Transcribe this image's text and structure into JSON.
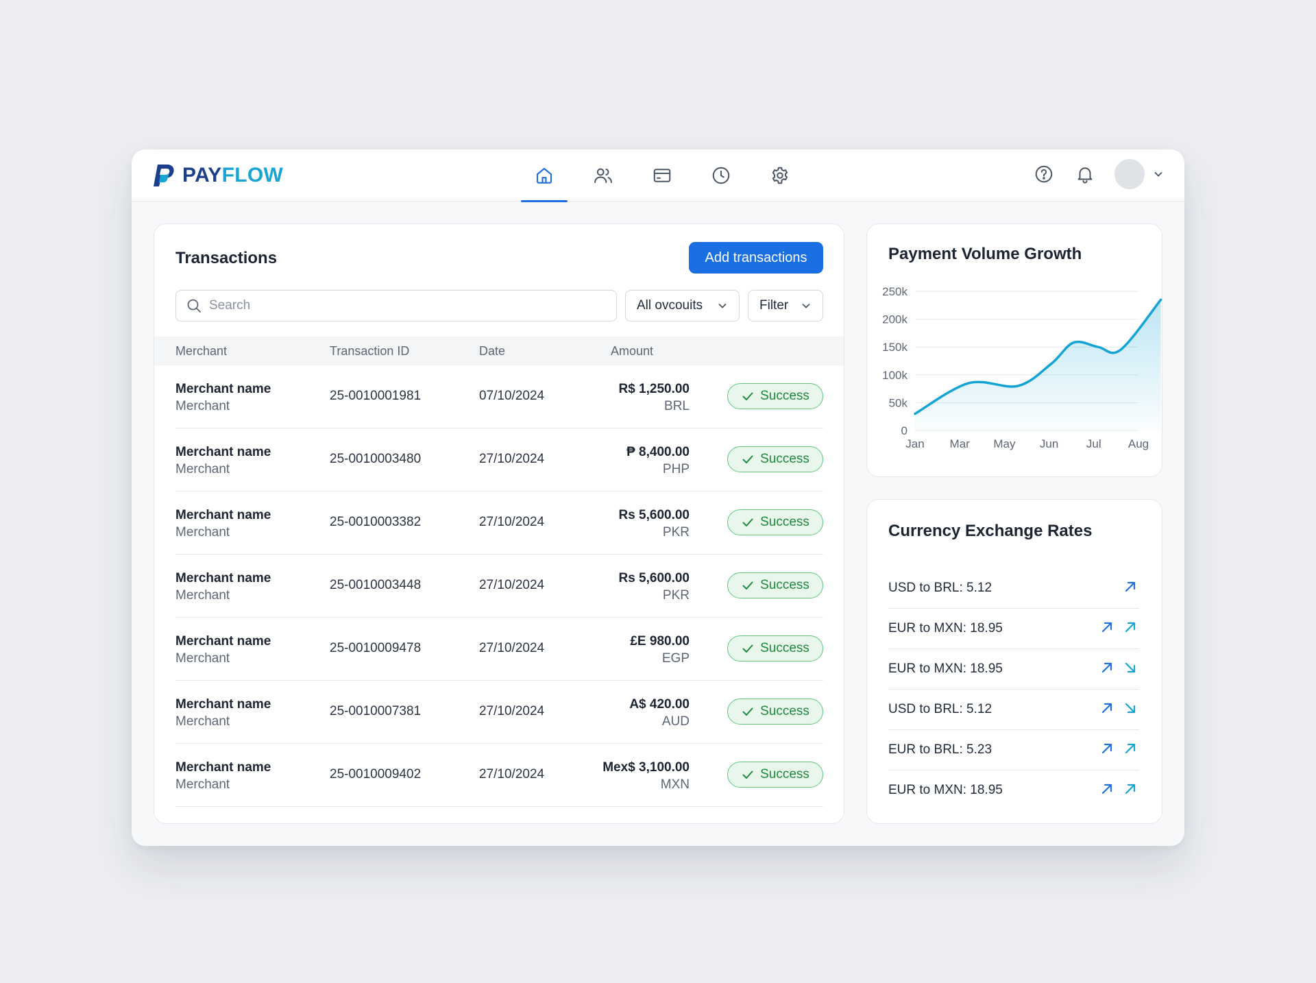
{
  "app": {
    "name_part1": "PAY",
    "name_part2": "FLOW"
  },
  "nav": [
    {
      "icon": "home-icon",
      "active": true
    },
    {
      "icon": "users-icon",
      "active": false
    },
    {
      "icon": "card-icon",
      "active": false
    },
    {
      "icon": "clock-icon",
      "active": false
    },
    {
      "icon": "settings-icon",
      "active": false
    }
  ],
  "transactions": {
    "title": "Transactions",
    "add_label": "Add transactions",
    "search_placeholder": "Search",
    "accounts_label": "All ovcouits",
    "filter_label": "Filter",
    "columns": {
      "merchant": "Merchant",
      "id": "Transaction ID",
      "date": "Date",
      "amount": "Amount"
    },
    "rows": [
      {
        "name": "Merchant name",
        "sub": "Merchant",
        "id": "25-0010001981",
        "date": "07/10/2024",
        "amount": "R$ 1,250.00",
        "currency": "BRL",
        "status": "Success"
      },
      {
        "name": "Merchant name",
        "sub": "Merchant",
        "id": "25-0010003480",
        "date": "27/10/2024",
        "amount": "₱ 8,400.00",
        "currency": "PHP",
        "status": "Success"
      },
      {
        "name": "Merchant name",
        "sub": "Merchant",
        "id": "25-0010003382",
        "date": "27/10/2024",
        "amount": "Rs 5,600.00",
        "currency": "PKR",
        "status": "Success"
      },
      {
        "name": "Merchant name",
        "sub": "Merchant",
        "id": "25-0010003448",
        "date": "27/10/2024",
        "amount": "Rs 5,600.00",
        "currency": "PKR",
        "status": "Success"
      },
      {
        "name": "Merchant name",
        "sub": "Merchant",
        "id": "25-0010009478",
        "date": "27/10/2024",
        "amount": "£E 980.00",
        "currency": "EGP",
        "status": "Success"
      },
      {
        "name": "Merchant name",
        "sub": "Merchant",
        "id": "25-0010007381",
        "date": "27/10/2024",
        "amount": "A$ 420.00",
        "currency": "AUD",
        "status": "Success"
      },
      {
        "name": "Merchant name",
        "sub": "Merchant",
        "id": "25-0010009402",
        "date": "27/10/2024",
        "amount": "Mex$ 3,100.00",
        "currency": "MXN",
        "status": "Success"
      }
    ]
  },
  "chart_data": {
    "type": "area",
    "title": "Payment Volume Growth",
    "categories": [
      "Jan",
      "Mar",
      "May",
      "Jun",
      "Jul",
      "Aug"
    ],
    "y_ticks": [
      "0",
      "50k",
      "100k",
      "150k",
      "200k",
      "250k"
    ],
    "ylim": [
      0,
      250000
    ],
    "x": [
      0,
      1.2,
      2.3,
      3.05,
      3.55,
      4.1,
      4.6,
      5.5
    ],
    "values": [
      30000,
      85000,
      80000,
      120000,
      158000,
      150000,
      145000,
      235000
    ],
    "color": "#13a3d4",
    "grid": true
  },
  "rates": {
    "title": "Currency Exchange Rates",
    "items": [
      {
        "label": "USD to BRL: 5.12",
        "arrows": [
          "up"
        ]
      },
      {
        "label": "EUR to MXN: 18.95",
        "arrows": [
          "up",
          "up"
        ]
      },
      {
        "label": "EUR to MXN: 18.95",
        "arrows": [
          "up",
          "down"
        ]
      },
      {
        "label": "USD to BRL: 5.12",
        "arrows": [
          "up",
          "down"
        ]
      },
      {
        "label": "EUR to BRL: 5.23",
        "arrows": [
          "up",
          "up"
        ]
      },
      {
        "label": "EUR to MXN: 18.95",
        "arrows": [
          "up",
          "up"
        ]
      }
    ]
  },
  "colors": {
    "primary": "#1a6fe3",
    "accent": "#13a3d4",
    "success": "#1d8a3e",
    "arrow_blue": "#1f6fe0"
  }
}
